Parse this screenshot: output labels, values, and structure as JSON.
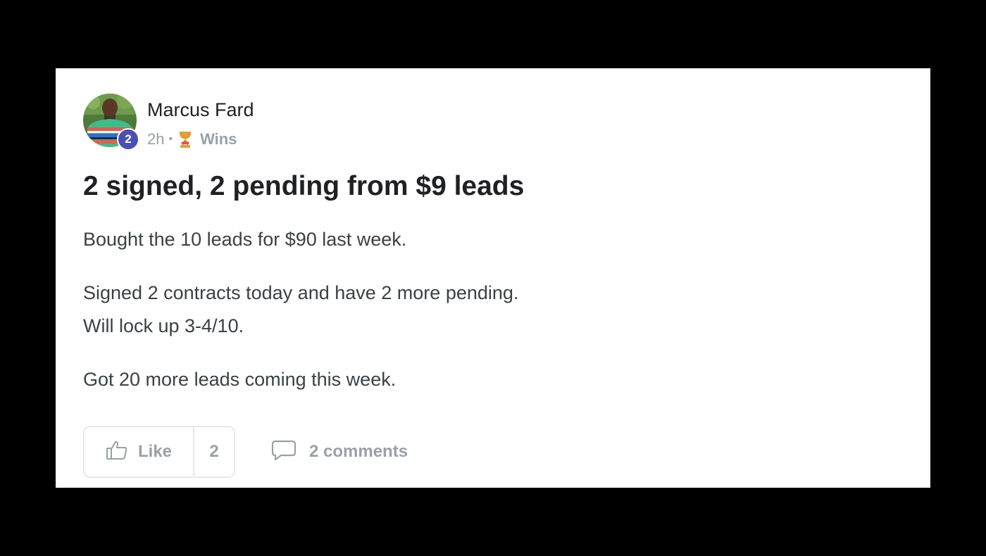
{
  "post": {
    "author": {
      "name": "Marcus Fard",
      "level": "2"
    },
    "meta": {
      "time": "2h",
      "separator": "•",
      "category": "Wins"
    },
    "title": "2 signed, 2 pending from $9 leads",
    "body": [
      "Bought the 10 leads for $90 last week.",
      "Signed 2 contracts today and have 2 more pending.",
      "Will lock up 3-4/10.",
      "Got 20 more leads coming this week."
    ],
    "actions": {
      "like_label": "Like",
      "like_count": "2",
      "comments_label": "2 comments"
    }
  },
  "icons": {
    "category": "trophy-icon",
    "like": "thumbs-up-icon",
    "comments": "speech-bubble-icon"
  },
  "colors": {
    "background": "#000000",
    "card": "#ffffff",
    "level_badge": "#4a4fb3",
    "muted_text": "#9aa0a6",
    "title_text": "#202124",
    "trophy_gold": "#e0a030",
    "trophy_red": "#d9534f"
  }
}
